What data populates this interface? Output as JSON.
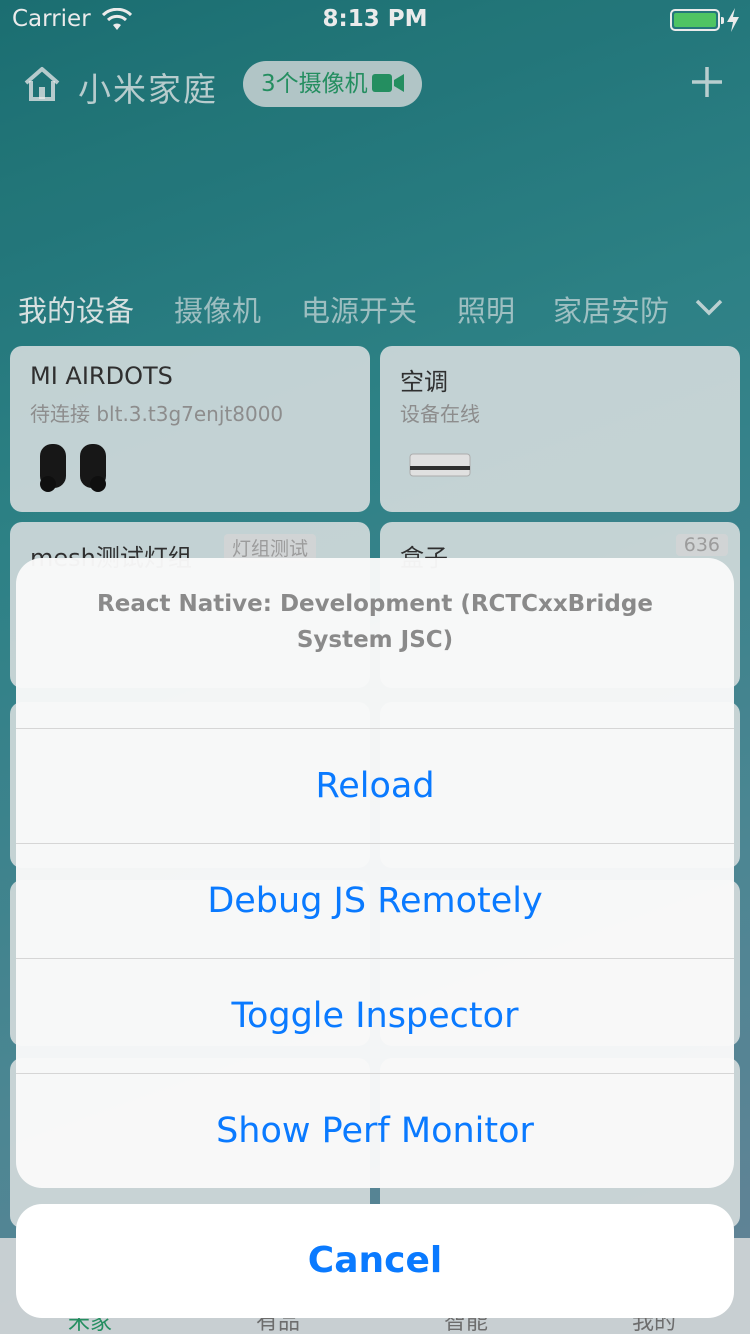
{
  "status_bar": {
    "carrier": "Carrier",
    "time": "8:13 PM"
  },
  "header": {
    "home_title": "小米家庭",
    "camera_pill": "3个摄像机",
    "accent": "#1e9e67"
  },
  "tabs": [
    "我的设备",
    "摄像机",
    "电源开关",
    "照明",
    "家居安防"
  ],
  "cards": [
    {
      "title": "MI AIRDOTS",
      "subtitle": "待连接 blt.3.t3g7enjt8000"
    },
    {
      "title": "空调",
      "subtitle": "设备在线"
    },
    {
      "title": "mesh测试灯组",
      "badge": "灯组测试"
    },
    {
      "title": "盒子",
      "badge": "636"
    }
  ],
  "bottom_tabs": [
    "米家",
    "有品",
    "智能",
    "我的"
  ],
  "action_sheet": {
    "title": "React Native: Development (RCTCxxBridge System JSC)",
    "options": [
      "Reload",
      "Debug JS Remotely",
      "Toggle Inspector",
      "Show Perf Monitor"
    ],
    "cancel": "Cancel",
    "tint": "#0a7aff"
  }
}
